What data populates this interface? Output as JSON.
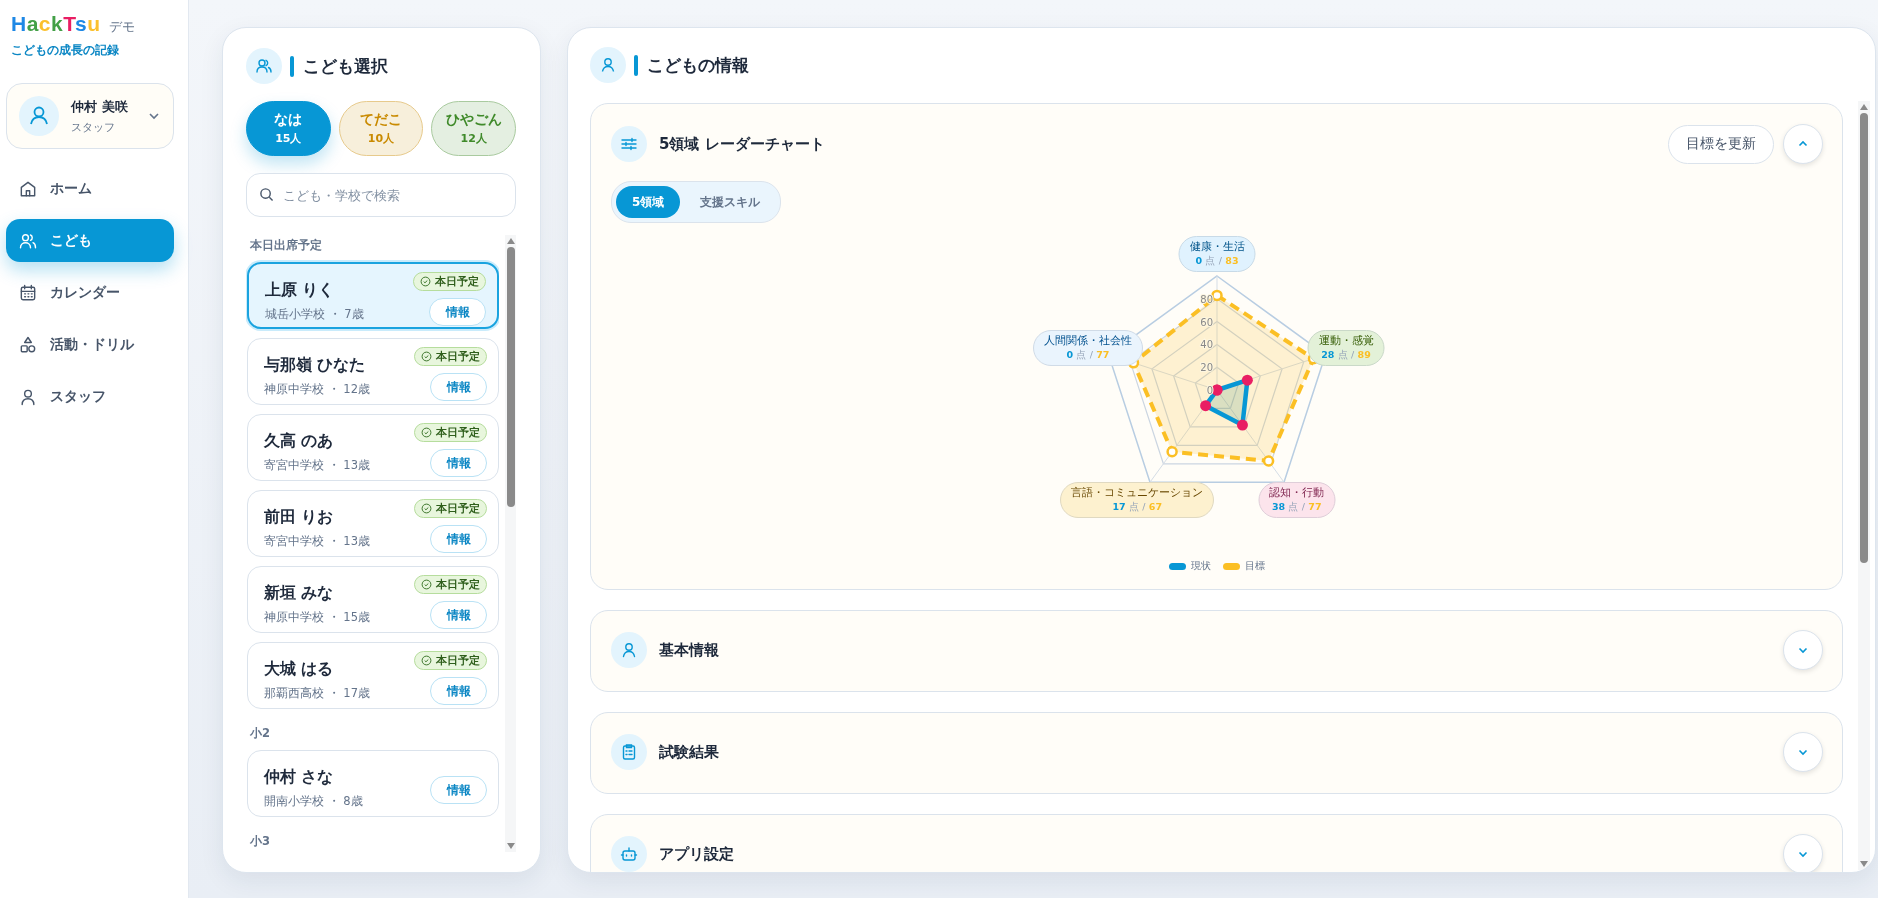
{
  "sidebar": {
    "logo": {
      "letters": [
        {
          "char": "H",
          "color": "#1e88e5"
        },
        {
          "char": "a",
          "color": "#43a047"
        },
        {
          "char": "c",
          "color": "#fbc02d"
        },
        {
          "char": "k",
          "color": "#43a047"
        },
        {
          "char": "T",
          "color": "#e91e63"
        },
        {
          "char": "s",
          "color": "#1e88e5"
        },
        {
          "char": "u",
          "color": "#fbc02d"
        }
      ],
      "tag": "デモ"
    },
    "subtitle": "こどもの成長の記録",
    "user": {
      "name": "仲村 美咲",
      "role": "スタッフ"
    },
    "nav": [
      {
        "label": "ホーム",
        "selected": false
      },
      {
        "label": "こども",
        "selected": true
      },
      {
        "label": "カレンダー",
        "selected": false
      },
      {
        "label": "活動・ドリル",
        "selected": false
      },
      {
        "label": "スタッフ",
        "selected": false
      }
    ]
  },
  "picker": {
    "title": "こども選択",
    "groups": [
      {
        "label": "なは",
        "count": "15人",
        "color": "#0797d5",
        "selected": true
      },
      {
        "label": "てだこ",
        "count": "10人",
        "color": "#c98a00",
        "selected": false
      },
      {
        "label": "ひやごん",
        "count": "12人",
        "color": "#3f8a2a",
        "selected": false
      }
    ],
    "search": {
      "placeholder": "こども・学校で検索"
    },
    "sections": [
      {
        "heading": "本日出席予定",
        "children": [
          {
            "name": "上原 りく",
            "meta": "城岳小学校 ・ 7歳",
            "badge": "本日予定",
            "button": "情報",
            "selected": true
          },
          {
            "name": "与那嶺 ひなた",
            "meta": "神原中学校 ・ 12歳",
            "badge": "本日予定",
            "button": "情報",
            "selected": false
          },
          {
            "name": "久高 のあ",
            "meta": "寄宮中学校 ・ 13歳",
            "badge": "本日予定",
            "button": "情報",
            "selected": false
          },
          {
            "name": "前田 りお",
            "meta": "寄宮中学校 ・ 13歳",
            "badge": "本日予定",
            "button": "情報",
            "selected": false
          },
          {
            "name": "新垣 みな",
            "meta": "神原中学校 ・ 15歳",
            "badge": "本日予定",
            "button": "情報",
            "selected": false
          },
          {
            "name": "大城 はる",
            "meta": "那覇西高校 ・ 17歳",
            "badge": "本日予定",
            "button": "情報",
            "selected": false
          }
        ]
      },
      {
        "heading": "小2",
        "children": [
          {
            "name": "仲村 さな",
            "meta": "開南小学校 ・ 8歳",
            "button": "情報",
            "selected": false
          }
        ]
      },
      {
        "heading": "小3"
      }
    ]
  },
  "info": {
    "title": "こどもの情報",
    "sections": [
      {
        "title": "5領域 レーダーチャート",
        "expanded": true,
        "action": "目標を更新",
        "tabs": [
          {
            "label": "5領域",
            "selected": true
          },
          {
            "label": "支援スキル",
            "selected": false
          }
        ],
        "radar": {
          "ticks": [
            "80",
            "60",
            "40",
            "20",
            "0"
          ],
          "axes": [
            {
              "label": "健康・生活",
              "score": "0",
              "unit": "点",
              "slash": "/",
              "goal": "83",
              "color": "#e0f2fe"
            },
            {
              "label": "人間関係・社会性",
              "score": "0",
              "unit": "点",
              "slash": "/",
              "goal": "77",
              "color": "#eaf4fd"
            },
            {
              "label": "運動・感覚",
              "score": "28",
              "unit": "点",
              "slash": "/",
              "goal": "89",
              "color": "#e3f1d8"
            },
            {
              "label": "言語・コミュニケーション",
              "score": "17",
              "unit": "点",
              "slash": "/",
              "goal": "67",
              "color": "#fdf1cf"
            },
            {
              "label": "認知・行動",
              "score": "38",
              "unit": "点",
              "slash": "/",
              "goal": "77",
              "color": "#fce4ec"
            }
          ],
          "series": [
            {
              "name": "現状",
              "color": "#0797d5"
            },
            {
              "name": "目標",
              "color": "#fbbf24"
            }
          ]
        }
      },
      {
        "title": "基本情報",
        "expanded": false
      },
      {
        "title": "試験結果",
        "expanded": false
      },
      {
        "title": "アプリ設定",
        "expanded": false
      }
    ]
  }
}
